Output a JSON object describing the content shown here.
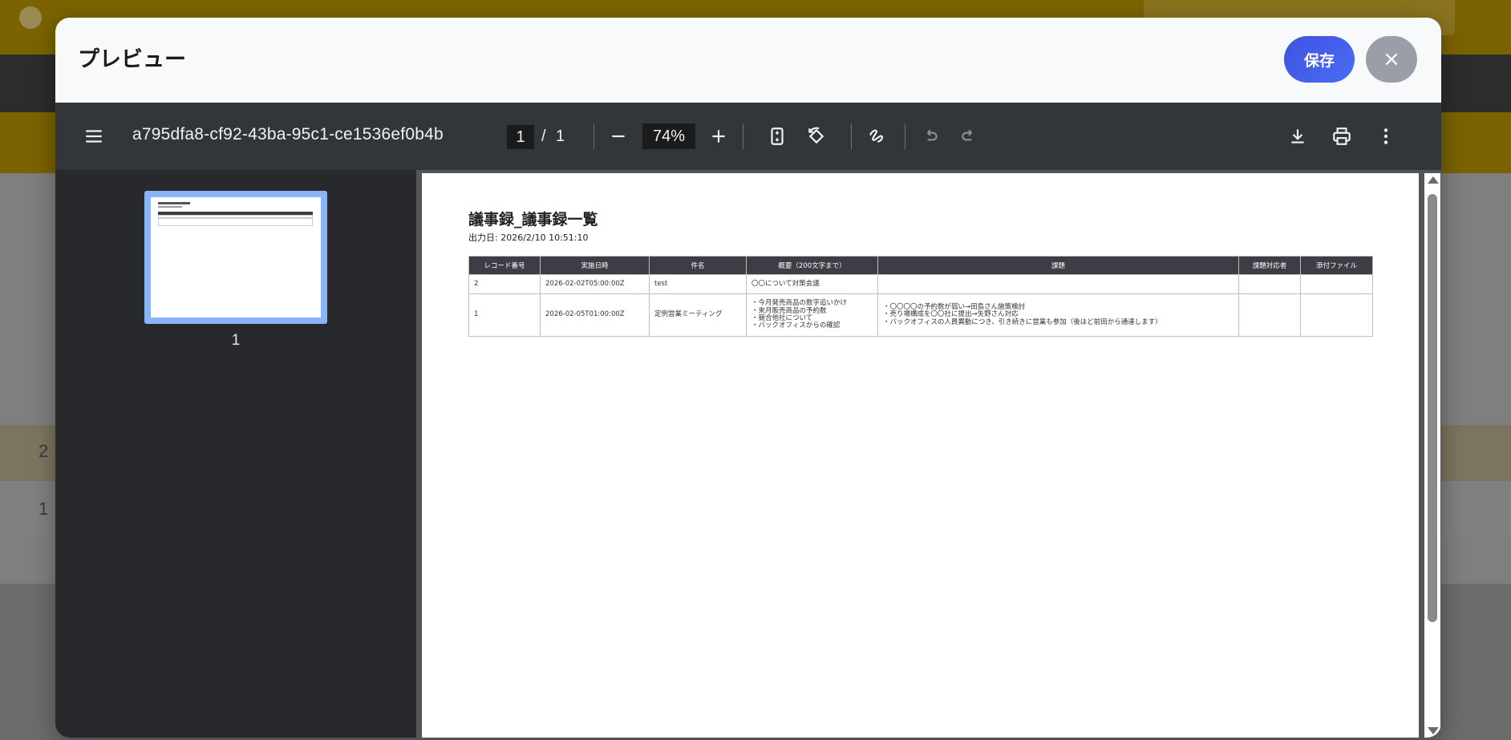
{
  "modal": {
    "title": "プレビュー",
    "save_label": "保存",
    "close_label": "×"
  },
  "viewer": {
    "doc_name": "a795dfa8-cf92-43ba-95c1-ce1536ef0b4b",
    "page_current": "1",
    "page_sep": "/",
    "page_total": "1",
    "zoom": "74%",
    "thumbnail_label": "1",
    "icons": [
      "menu-icon",
      "zoom-out-icon",
      "zoom-in-icon",
      "fit-page-icon",
      "rotate-icon",
      "annotate-icon",
      "undo-icon",
      "redo-icon",
      "download-icon",
      "print-icon",
      "more-icon"
    ]
  },
  "document": {
    "title": "議事録_議事録一覧",
    "date": "出力日: 2026/2/10 10:51:10",
    "headers": [
      "レコード番号",
      "実施日時",
      "件名",
      "概要（200文字まで）",
      "課題",
      "課題対応者",
      "添付ファイル"
    ],
    "rows": [
      [
        "2",
        "2026-02-02T05:00:00Z",
        "test",
        "〇〇について対策会議",
        "",
        "",
        ""
      ],
      [
        "1",
        "2026-02-05T01:00:00Z",
        "定例営業ミーティング",
        "・今月発売商品の数字追いかけ\n・来月販売商品の予約数\n・競合他社について\n・バックオフィスからの確認",
        "・〇〇〇〇の予約数が弱い→田島さん施策検討\n・売り場構成を〇〇社に提出→矢野さん対応\n・バックオフィスの人員異動につき、引き続きに営業も参加（後ほど前田から通達します）",
        "",
        ""
      ]
    ]
  },
  "background": {
    "row_numbers": [
      "2",
      "1"
    ]
  }
}
